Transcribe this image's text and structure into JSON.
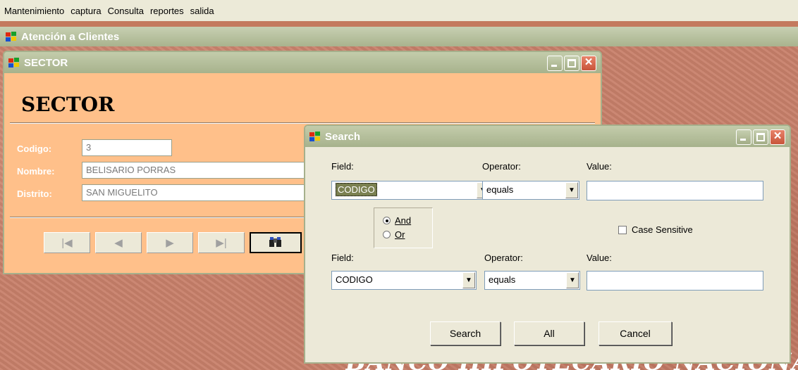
{
  "menubar": {
    "items": [
      {
        "label": "Mantenimiento"
      },
      {
        "label": "captura"
      },
      {
        "label": "Consulta"
      },
      {
        "label": "reportes"
      },
      {
        "label": "salida"
      }
    ]
  },
  "app": {
    "title": "Atención a Clientes"
  },
  "sector_window": {
    "title": "SECTOR",
    "heading": "SECTOR",
    "fields": {
      "codigo": {
        "label": "Codigo:",
        "value": "3"
      },
      "nombre": {
        "label": "Nombre:",
        "value": "BELISARIO PORRAS"
      },
      "distrito": {
        "label": "Distrito:",
        "value": "SAN MIGUELITO"
      }
    },
    "nav": {
      "first": "|◀",
      "prev": "◀",
      "next": "▶",
      "last": "▶|"
    }
  },
  "search_dialog": {
    "title": "Search",
    "row1": {
      "field_label": "Field:",
      "field_value": "CODIGO",
      "operator_label": "Operator:",
      "operator_value": "equals",
      "value_label": "Value:"
    },
    "logic": {
      "and": "And",
      "or": "Or",
      "selected": "And"
    },
    "case_sensitive": "Case Sensitive",
    "row2": {
      "field_label": "Field:",
      "field_value": "CODIGO",
      "operator_label": "Operator:",
      "operator_value": "equals",
      "value_label": "Value:"
    },
    "buttons": {
      "search": "Search",
      "all": "All",
      "cancel": "Cancel"
    }
  },
  "background": {
    "banner": "BANCO HIPOTECARIO NACIONAL"
  }
}
